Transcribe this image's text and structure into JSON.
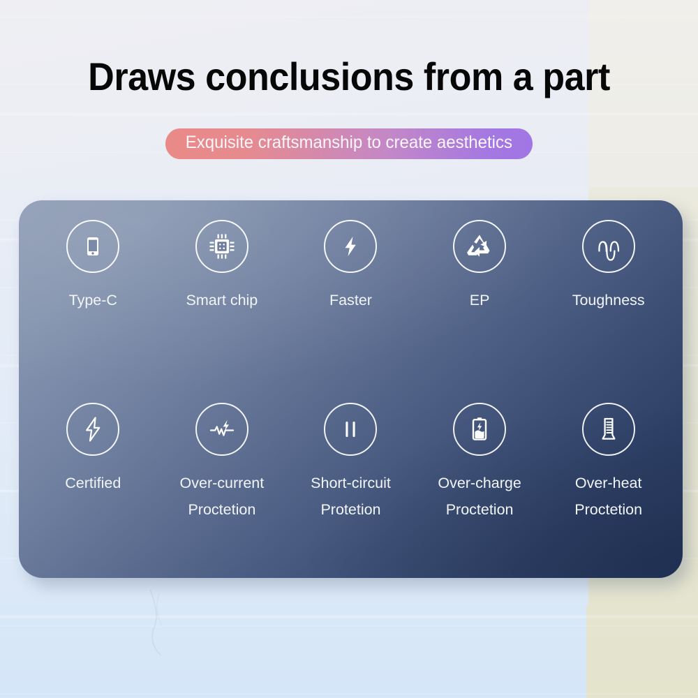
{
  "header": {
    "title": "Draws conclusions from a part",
    "badge_text": "Exquisite craftsmanship to create aesthetics",
    "badge_gradient_from": "#ea8a87",
    "badge_gradient_to": "#a175e4"
  },
  "panel": {
    "background_from": "#8e9cb4",
    "background_to": "#25375c",
    "text_color": "#f2f5f8"
  },
  "background": {
    "top_left_color": "#eceef3",
    "top_right_color": "#edece6",
    "bottom_left_color": "#d8e7f8",
    "bottom_right_color": "#e5e4cf"
  },
  "features": {
    "row1": [
      {
        "icon": "smartphone-icon",
        "label": "Type-C",
        "line2": ""
      },
      {
        "icon": "cpu-chip-icon",
        "label": "Smart chip",
        "line2": ""
      },
      {
        "icon": "lightning-bolt-icon",
        "label": "Faster",
        "line2": ""
      },
      {
        "icon": "recycle-icon",
        "label": "EP",
        "line2": ""
      },
      {
        "icon": "wave-loops-icon",
        "label": "Toughness",
        "line2": ""
      }
    ],
    "row2": [
      {
        "icon": "bolt-outline-icon",
        "label": "Certified",
        "line2": ""
      },
      {
        "icon": "pulse-bolt-icon",
        "label": "Over-current",
        "line2": "Proctetion"
      },
      {
        "icon": "pause-bars-icon",
        "label": "Short-circuit",
        "line2": "Protetion"
      },
      {
        "icon": "battery-bolt-icon",
        "label": "Over-charge",
        "line2": "Proctetion"
      },
      {
        "icon": "thermometer-cylinder-icon",
        "label": "Over-heat",
        "line2": "Proctetion"
      }
    ]
  }
}
